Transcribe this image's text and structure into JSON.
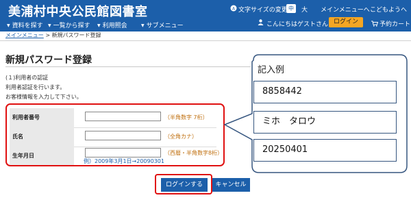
{
  "header": {
    "site_title": "美浦村中央公民館図書室",
    "font_size_label": "文字サイズの変更",
    "font_size_mid": "中",
    "font_size_large": "大",
    "menu_link": "メインメニューへ",
    "kids_link": "こどもようへ",
    "nav": [
      "資料を探す",
      "一覧から探す",
      "利用照会",
      "サブメニュー"
    ],
    "greeting": "こんにちはゲストさん",
    "login_label": "ログイン",
    "cart_label": "予約カート"
  },
  "breadcrumb": {
    "home": "メインメニュー",
    "separator": ">",
    "current": "新規パスワード登録"
  },
  "page": {
    "title": "新規パスワード登録",
    "section": "(１)利用者の認証",
    "line1": "利用者認証を行います。",
    "line2": "お客様情報を入力して下さい。"
  },
  "form": {
    "fields": [
      {
        "label": "利用者番号",
        "value": "",
        "hint": "（半角数字 7桁）"
      },
      {
        "label": "氏名",
        "value": "",
        "hint": "（全角カナ）"
      },
      {
        "label": "生年月日",
        "value": "",
        "hint": "（西暦・半角数字8桁）"
      }
    ],
    "example": "例）2009年3月1日→20090301"
  },
  "buttons": {
    "login": "ログインする",
    "cancel": "キャンセル"
  },
  "callout": {
    "title": "記入例",
    "values": [
      "8858442",
      "ミホ　タロウ",
      "20250401"
    ]
  },
  "colors": {
    "header_bg": "#1c5faa",
    "highlight_red": "#e01010",
    "hint_orange": "#c07010"
  }
}
